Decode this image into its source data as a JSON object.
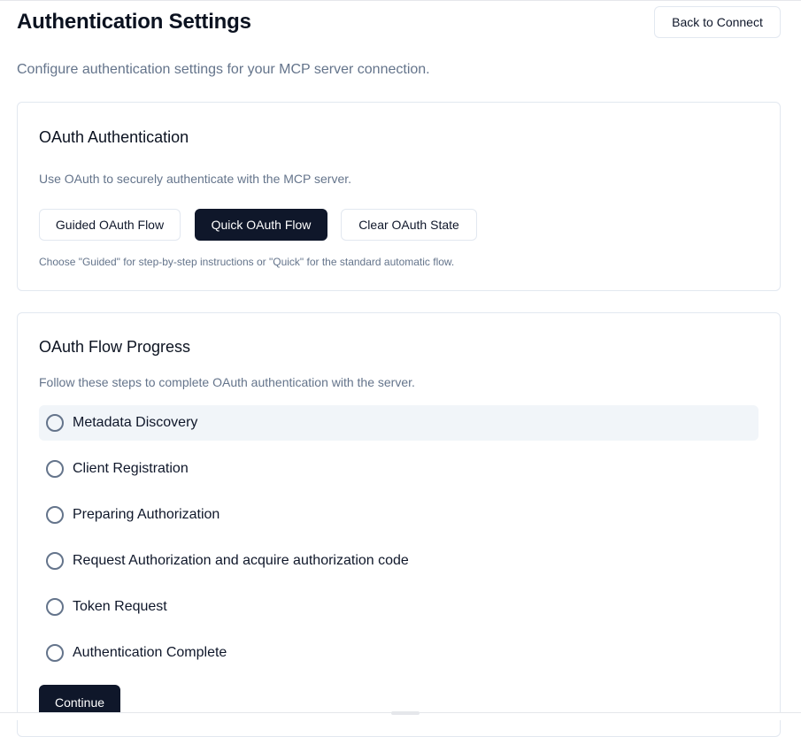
{
  "header": {
    "title": "Authentication Settings",
    "back_button_label": "Back to Connect",
    "description": "Configure authentication settings for your MCP server connection."
  },
  "oauth_card": {
    "title": "OAuth Authentication",
    "description": "Use OAuth to securely authenticate with the MCP server.",
    "buttons": [
      {
        "label": "Guided OAuth Flow",
        "variant": "outline"
      },
      {
        "label": "Quick OAuth Flow",
        "variant": "solid"
      },
      {
        "label": "Clear OAuth State",
        "variant": "outline"
      }
    ],
    "hint": "Choose \"Guided\" for step-by-step instructions or \"Quick\" for the standard automatic flow."
  },
  "progress_card": {
    "title": "OAuth Flow Progress",
    "description": "Follow these steps to complete OAuth authentication with the server.",
    "steps": [
      {
        "label": "Metadata Discovery",
        "active": true
      },
      {
        "label": "Client Registration",
        "active": false
      },
      {
        "label": "Preparing Authorization",
        "active": false
      },
      {
        "label": "Request Authorization and acquire authorization code",
        "active": false
      },
      {
        "label": "Token Request",
        "active": false
      },
      {
        "label": "Authentication Complete",
        "active": false
      }
    ],
    "continue_label": "Continue"
  },
  "colors": {
    "primary": "#0f172a",
    "muted_text": "#64748b",
    "border": "#e2e8f0",
    "active_step_bg": "#f1f5f9"
  }
}
